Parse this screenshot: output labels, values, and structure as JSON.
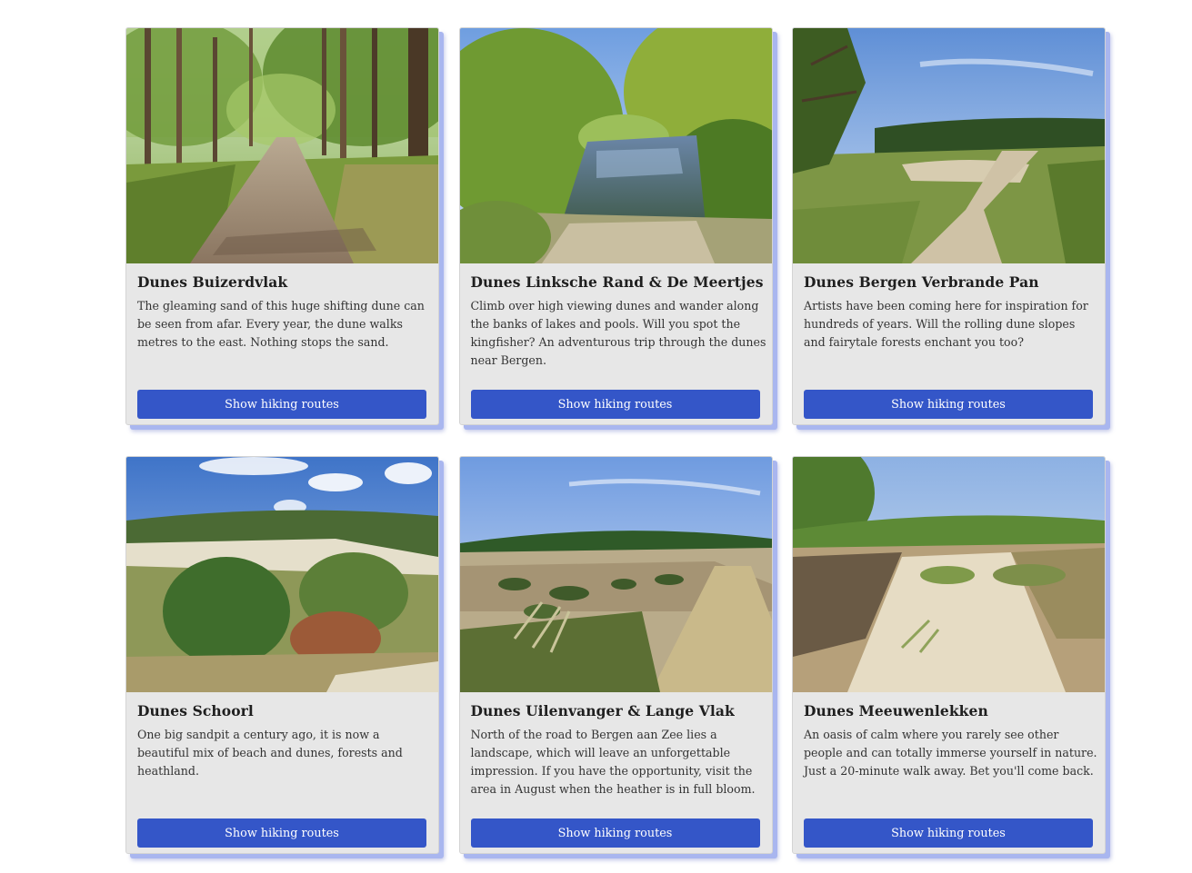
{
  "cards": [
    {
      "title": "Dunes Buizerdvlak",
      "description": "The gleaming sand of this huge shifting dune can be seen from afar. Every year, the dune walks metres to the east. Nothing stops the sand.",
      "button_label": "Show hiking routes",
      "photo": "forest-sand-path"
    },
    {
      "title": "Dunes Linksche Rand & De Meertjes",
      "description": "Climb over high viewing dunes and wander along the banks of lakes and pools. Will you spot the kingfisher? An adventurous trip through the dunes near Bergen.",
      "button_label": "Show hiking routes",
      "photo": "dune-pond-with-trees"
    },
    {
      "title": "Dunes Bergen Verbrande Pan",
      "description": "Artists have been coming here for inspiration for hundreds of years. Will the rolling dune slopes and fairytale forests enchant you too?",
      "button_label": "Show hiking routes",
      "photo": "winding-path-through-heath"
    },
    {
      "title": "Dunes Schoorl",
      "description": "One big sandpit a century ago, it is now a beautiful mix of beach and dunes, forests and heathland.",
      "button_label": "Show hiking routes",
      "photo": "sandpit-with-pines"
    },
    {
      "title": "Dunes Uilenvanger & Lange Vlak",
      "description": "North of the road to Bergen aan Zee lies a landscape, which will leave an unforgettable impression. If you have the opportunity, visit the area in August when the heather is in full bloom.",
      "button_label": "Show hiking routes",
      "photo": "heath-valley-with-path"
    },
    {
      "title": "Dunes Meeuwenlekken",
      "description": "An oasis of calm where you rarely see other people and can totally immerse yourself in nature. Just a 20-minute walk away. Bet you'll come back.",
      "button_label": "Show hiking routes",
      "photo": "sandy-dune-trail"
    }
  ],
  "colors": {
    "button": "#3456c8",
    "card_background": "#e7e7e7",
    "card_shadow": "#a9b6ef"
  }
}
